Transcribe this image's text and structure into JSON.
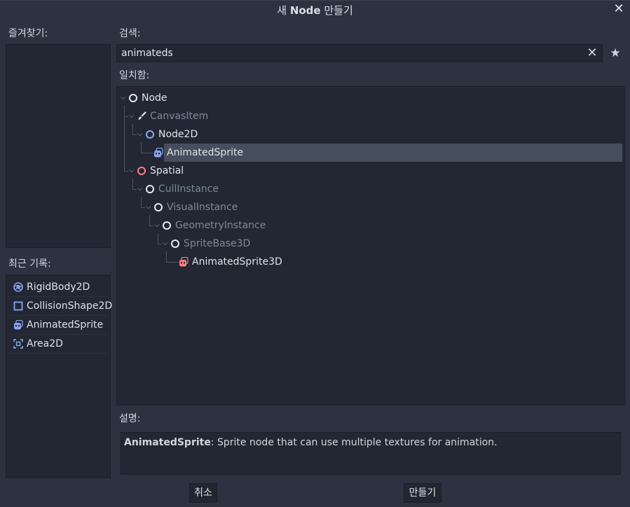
{
  "window": {
    "title_prefix": "새 ",
    "title_bold": "Node",
    "title_suffix": " 만들기",
    "close_icon": "✕"
  },
  "favorites": {
    "label": "즐겨찾기:"
  },
  "recent": {
    "label": "최근 기록:",
    "items": [
      {
        "label": "RigidBody2D",
        "icon": "rigidbody2d-icon"
      },
      {
        "label": "CollisionShape2D",
        "icon": "collisionshape2d-icon"
      },
      {
        "label": "AnimatedSprite",
        "icon": "animatedsprite-icon"
      },
      {
        "label": "Area2D",
        "icon": "area2d-icon"
      }
    ]
  },
  "search": {
    "label": "검색:",
    "value": "animateds",
    "clear_icon": "✕",
    "favorite_icon": "★"
  },
  "matches": {
    "label": "일치함:",
    "tree": [
      {
        "label": "Node",
        "style": "bright"
      },
      {
        "label": "CanvasItem",
        "style": "dim"
      },
      {
        "label": "Node2D",
        "style": "bright"
      },
      {
        "label": "AnimatedSprite",
        "style": "bright",
        "selected": true
      },
      {
        "label": "Spatial",
        "style": "bright"
      },
      {
        "label": "CullInstance",
        "style": "dim"
      },
      {
        "label": "VisualInstance",
        "style": "dim"
      },
      {
        "label": "GeometryInstance",
        "style": "dim"
      },
      {
        "label": "SpriteBase3D",
        "style": "dim"
      },
      {
        "label": "AnimatedSprite3D",
        "style": "bright"
      }
    ]
  },
  "description": {
    "label": "설명:",
    "node_name": "AnimatedSprite",
    "text": ": Sprite node that can use multiple textures for animation."
  },
  "buttons": {
    "cancel": "취소",
    "create": "만들기"
  },
  "colors": {
    "background": "#2c3240",
    "panel": "#222733",
    "selection": "#464d5d",
    "node2d": "#8da5f3",
    "spatial": "#fc7f7f"
  }
}
